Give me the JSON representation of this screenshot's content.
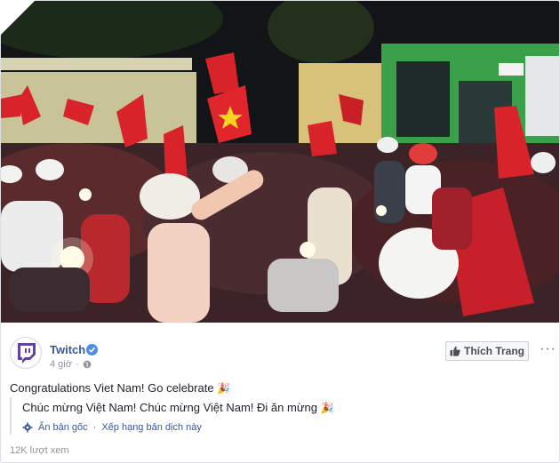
{
  "post": {
    "page_name": "Twitch",
    "time": "4 giờ",
    "like_page_label": "Thích Trang",
    "more_label": "···",
    "text": "Congratulations Viet Nam! Go celebrate",
    "text_emoji": "🎉",
    "translation_text": "Chúc mừng Việt Nam! Chúc mừng Việt Nam! Đi ăn mừng",
    "translation_emoji": "🎉",
    "hide_original_label": "Ẩn bản gốc",
    "rate_translation_label": "Xếp hạng bản dịch này",
    "separator": "·",
    "views": "12K lượt xem"
  },
  "icons": {
    "verified": "verified-check-icon",
    "globe": "globe-icon",
    "thumbs_up": "thumbs-up-icon",
    "translate_gear": "gear-icon",
    "avatar": "twitch-logo-icon"
  },
  "colors": {
    "link": "#385898",
    "twitch_purple": "#6441a4",
    "verified": "#4a90e2"
  }
}
